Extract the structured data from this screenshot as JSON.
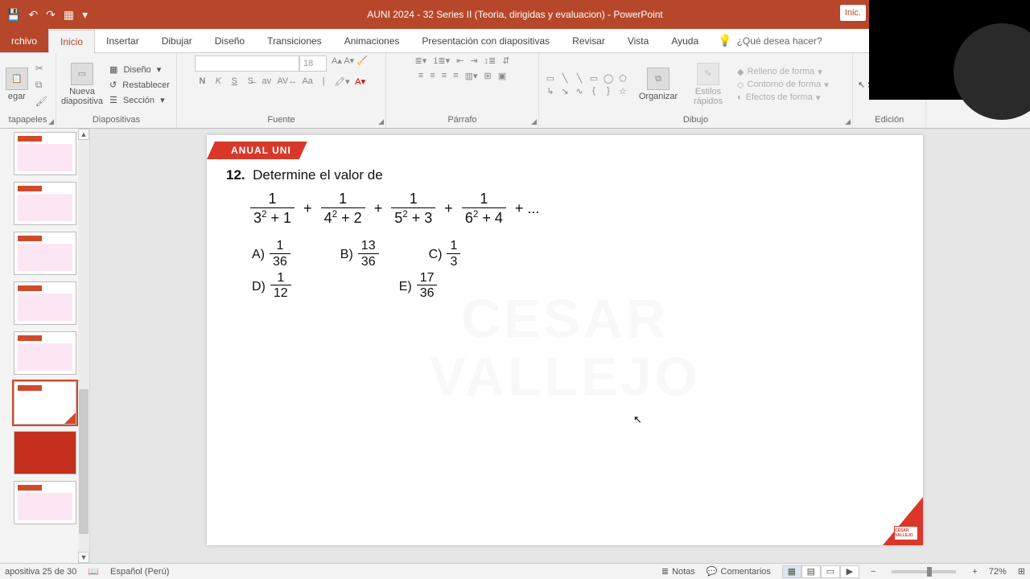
{
  "title_bar": {
    "title": "AUNI 2024 - 32 Series II (Teoria, dirigidas y evaluacion)  -  PowerPoint",
    "right_chip": "Inic.",
    "qat_icons": [
      "save-icon",
      "undo-icon",
      "redo-icon",
      "present-icon",
      "customize-icon"
    ]
  },
  "tabs": {
    "file": "rchivo",
    "items": [
      "Inicio",
      "Insertar",
      "Dibujar",
      "Diseño",
      "Transiciones",
      "Animaciones",
      "Presentación con diapositivas",
      "Revisar",
      "Vista",
      "Ayuda"
    ],
    "active_index": 0,
    "tell_me": "¿Qué desea hacer?"
  },
  "ribbon": {
    "clipboard": {
      "paste": "egar",
      "group_label": "tapapeles"
    },
    "slides": {
      "new_slide": "Nueva\ndiapositiva",
      "layout": "Diseño",
      "reset": "Restablecer",
      "section": "Sección",
      "group_label": "Diapositivas"
    },
    "font": {
      "font_name": "",
      "font_size": "18",
      "bold": "N",
      "italic": "K",
      "underline": "S",
      "strike": "S",
      "shadow": "av",
      "clear": "A̶",
      "case": "Aa",
      "group_label": "Fuente"
    },
    "paragraph": {
      "group_label": "Párrafo"
    },
    "drawing": {
      "arrange": "Organizar",
      "quick": "Estilos\nrápidos",
      "fill": "Relleno de forma",
      "outline": "Contorno de forma",
      "effects": "Efectos de forma",
      "group_label": "Dibujo"
    },
    "editing": {
      "select": "Seleccionar",
      "group_label": "Edición"
    }
  },
  "slide": {
    "badge": "ANUAL UNI",
    "q_number": "12.",
    "q_text": "Determine el valor de",
    "series_terms": [
      {
        "num": "1",
        "den": "3² + 1"
      },
      {
        "num": "1",
        "den": "4² + 2"
      },
      {
        "num": "1",
        "den": "5² + 3"
      },
      {
        "num": "1",
        "den": "6² + 4"
      }
    ],
    "series_tail": "+ ...",
    "options": {
      "A": {
        "num": "1",
        "den": "36"
      },
      "B": {
        "num": "13",
        "den": "36"
      },
      "C": {
        "num": "1",
        "den": "3"
      },
      "D": {
        "num": "1",
        "den": "12"
      },
      "E": {
        "num": "17",
        "den": "36"
      }
    },
    "watermark_l1": "CESAR",
    "watermark_l2": "VALLEJO",
    "logo": "CESAR VALLEJO"
  },
  "status": {
    "slide_counter": "apositiva 25 de 30",
    "language": "Español (Perú)",
    "notes": "Notas",
    "comments": "Comentarios",
    "zoom": "72%"
  }
}
